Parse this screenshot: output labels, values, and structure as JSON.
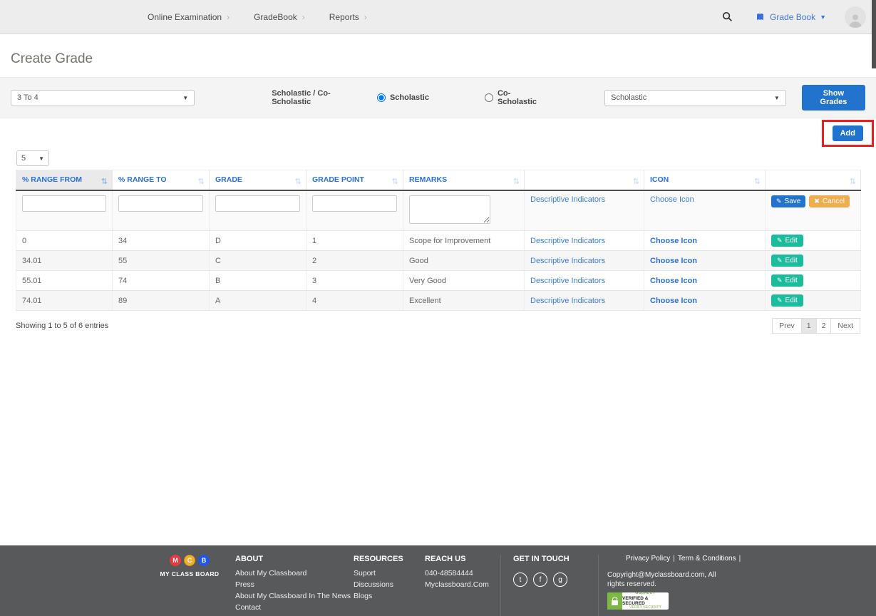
{
  "icons": {
    "nav_chevron_glyph": "›",
    "caret_down_glyph": "▼",
    "menu_caret_glyph": "▼",
    "sort_glyph": "⇅",
    "edit_glyph": "✎",
    "cancel_glyph": "✖"
  },
  "topbar": {
    "nav_items": [
      "Online Examination",
      "GradeBook",
      "Reports"
    ],
    "user_menu_label": "Grade Book"
  },
  "page_title": "Create Grade",
  "filter_bar": {
    "class_dropdown_value": "3 To 4",
    "type_label": "Scholastic / Co-Scholastic",
    "radios": [
      {
        "label": "Scholastic",
        "selected": true
      },
      {
        "label": "Co-Scholastic",
        "selected": false
      }
    ],
    "category_dropdown_value": "Scholastic",
    "show_grades_button": "Show Grades"
  },
  "toolbar": {
    "add_button": "Add",
    "page_size_value": "5"
  },
  "grades_table": {
    "headers": [
      "% RANGE FROM",
      "% RANGE TO",
      "GRADE",
      "GRADE POINT",
      "REMARKS",
      "",
      "ICON",
      ""
    ],
    "entry_row": {
      "descriptive_link": "Descriptive Indicators",
      "choose_icon_link": "Choose Icon",
      "save_button": "Save",
      "cancel_button": "Cancel"
    },
    "rows": [
      {
        "range_from": "0",
        "range_to": "34",
        "grade": "D",
        "grade_point": "1",
        "remarks": "Scope for Improvement",
        "descriptive_link": "Descriptive Indicators",
        "choose_icon_link": "Choose Icon",
        "edit_label": "Edit"
      },
      {
        "range_from": "34.01",
        "range_to": "55",
        "grade": "C",
        "grade_point": "2",
        "remarks": "Good",
        "descriptive_link": "Descriptive Indicators",
        "choose_icon_link": "Choose Icon",
        "edit_label": "Edit"
      },
      {
        "range_from": "55.01",
        "range_to": "74",
        "grade": "B",
        "grade_point": "3",
        "remarks": "Very Good",
        "descriptive_link": "Descriptive Indicators",
        "choose_icon_link": "Choose Icon",
        "edit_label": "Edit"
      },
      {
        "range_from": "74.01",
        "range_to": "89",
        "grade": "A",
        "grade_point": "4",
        "remarks": "Excellent",
        "descriptive_link": "Descriptive Indicators",
        "choose_icon_link": "Choose Icon",
        "edit_label": "Edit"
      }
    ],
    "summary": "Showing 1 to 5 of 6 entries",
    "pagination": {
      "prev": "Prev",
      "pages": [
        "1",
        "2"
      ],
      "next": "Next",
      "active_page": "1"
    }
  },
  "footer": {
    "brand": {
      "circles": [
        {
          "letter": "M",
          "color": "#e23b3f"
        },
        {
          "letter": "C",
          "color": "#efaf2f"
        },
        {
          "letter": "B",
          "color": "#2257e6"
        }
      ],
      "name": "MY CLASS BOARD"
    },
    "about": {
      "title": "ABOUT",
      "links": [
        "About My Classboard",
        "Press",
        "About My Classboard In The News",
        "Contact"
      ]
    },
    "resources": {
      "title": "RESOURCES",
      "links": [
        "Suport",
        "Discussions",
        "Blogs"
      ]
    },
    "reach": {
      "title": "REACH US",
      "lines": [
        "040-48584444",
        "Myclassboard.Com"
      ]
    },
    "touch": {
      "title": "GET IN TOUCH",
      "social": [
        {
          "name": "twitter",
          "glyph": "t"
        },
        {
          "name": "facebook",
          "glyph": "f"
        },
        {
          "name": "google",
          "glyph": "g"
        }
      ]
    },
    "legal": {
      "privacy_link": "Privacy Policy",
      "terms_link": "Term & Conditions",
      "separator": "|",
      "copyright": "Copyright@Myclassboard.com, All rights reserved.",
      "badge": {
        "brand": "GODADDY",
        "line1": "VERIFIED & SECURED",
        "line2": "VERIFY SECURITY"
      }
    }
  },
  "colors": {
    "primary_blue": "#2173cd",
    "header_blue": "#2a6fdb",
    "link_blue": "#3b7dd8",
    "edit_teal": "#1abc9c",
    "cancel_orange": "#f0ad4e",
    "highlight_red": "#ee1d23",
    "footer_bg": "#58595b"
  }
}
